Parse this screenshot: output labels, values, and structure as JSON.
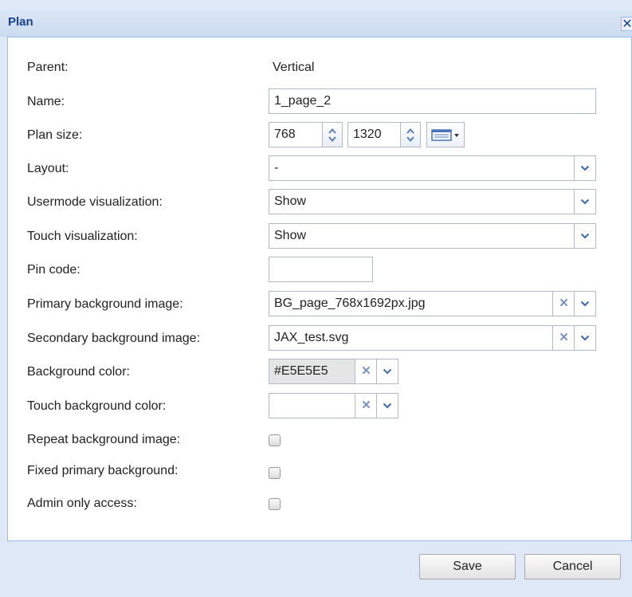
{
  "dialog": {
    "title": "Plan",
    "close_glyph": "✕"
  },
  "fields": {
    "parent": {
      "label": "Parent:",
      "value": "Vertical"
    },
    "name": {
      "label": "Name:",
      "value": "1_page_2"
    },
    "plan_size": {
      "label": "Plan size:",
      "width": "768",
      "height": "1320",
      "preset_icon": "list-icon"
    },
    "layout": {
      "label": "Layout:",
      "value": "-"
    },
    "usermode_visualization": {
      "label": "Usermode visualization:",
      "value": "Show"
    },
    "touch_visualization": {
      "label": "Touch visualization:",
      "value": "Show"
    },
    "pin_code": {
      "label": "Pin code:",
      "value": ""
    },
    "primary_background_image": {
      "label": "Primary background image:",
      "value": "BG_page_768x1692px.jpg"
    },
    "secondary_background_image": {
      "label": "Secondary background image:",
      "value": "JAX_test.svg"
    },
    "background_color": {
      "label": "Background color:",
      "value": "#E5E5E5",
      "swatch": "#E5E5E5"
    },
    "touch_background_color": {
      "label": "Touch background color:",
      "value": ""
    },
    "repeat_background_image": {
      "label": "Repeat background image:",
      "checked": false
    },
    "fixed_primary_background": {
      "label": "Fixed primary background:",
      "checked": false
    },
    "admin_only_access": {
      "label": "Admin only access:",
      "checked": false
    }
  },
  "buttons": {
    "save": "Save",
    "cancel": "Cancel"
  },
  "colors": {
    "title_text": "#15428b",
    "frame": "#dfe8f6",
    "border": "#99bbe8",
    "clear_x": "#7a93bf"
  }
}
